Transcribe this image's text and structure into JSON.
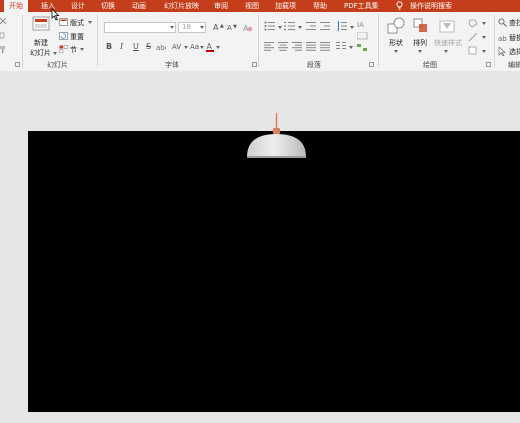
{
  "tabs": {
    "home": "开始",
    "insert": "插入",
    "design": "设计",
    "transitions": "切换",
    "animations": "动画",
    "slideshow": "幻灯片放映",
    "review": "审阅",
    "view": "视图",
    "addins": "加载项",
    "help": "帮助",
    "pdf": "PDF工具集",
    "tellme": "操作说明搜索"
  },
  "slides_group": {
    "new_slide_line1": "新建",
    "new_slide_line2": "幻灯片",
    "layout": "版式",
    "reset": "重置",
    "section": "节",
    "label": "幻灯片"
  },
  "font_group": {
    "font_size": "18",
    "bold": "B",
    "italic": "I",
    "underline": "U",
    "strike": "S",
    "charspacing": "AV",
    "changecase": "Aa",
    "grow": "A",
    "shrink": "A",
    "label": "字体"
  },
  "paragraph_group": {
    "label": "段落"
  },
  "drawing_group": {
    "shapes": "形状",
    "arrange": "排列",
    "quick_styles": "快速样式",
    "label": "绘图"
  },
  "editing_group": {
    "find": "查找",
    "replace": "替换",
    "select": "选择",
    "label": "编辑"
  },
  "colors": {
    "accent": "#c43e1c",
    "ribbon": "#f3f3f3",
    "workspace": "#e6e6e6",
    "slide": "#000000",
    "lamp_shade": "#e4e4e4",
    "lamp_cord": "#e07a4e"
  }
}
